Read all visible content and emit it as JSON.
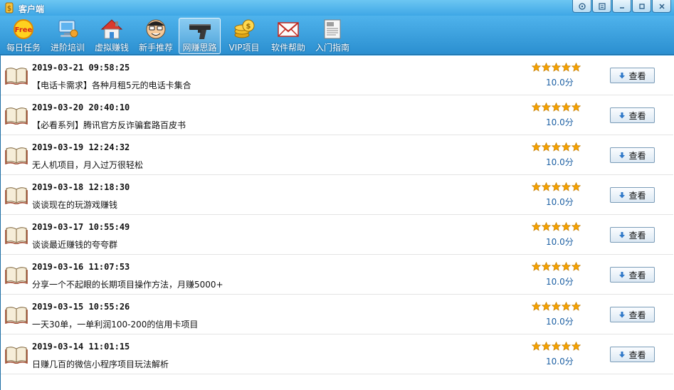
{
  "window": {
    "title": "客户端",
    "controls": [
      "skin-icon",
      "menu-icon",
      "minimize-icon",
      "maximize-icon",
      "close-icon"
    ]
  },
  "toolbar": {
    "items": [
      {
        "label": "每日任务",
        "icon": "free-badge-icon"
      },
      {
        "label": "进阶培训",
        "icon": "computer-icon"
      },
      {
        "label": "虚拟赚钱",
        "icon": "house-icon"
      },
      {
        "label": "新手推荐",
        "icon": "face-icon"
      },
      {
        "label": "网赚思路",
        "icon": "gun-icon",
        "active": true
      },
      {
        "label": "VIP项目",
        "icon": "coins-icon"
      },
      {
        "label": "软件帮助",
        "icon": "envelope-icon"
      },
      {
        "label": "入门指南",
        "icon": "newspaper-icon"
      }
    ]
  },
  "list": {
    "view_label": "查看",
    "rows": [
      {
        "date": "2019-03-21 09:58:25",
        "title": "【电话卡需求】各种月租5元的电话卡集合",
        "rating": 5,
        "score": "10.0分"
      },
      {
        "date": "2019-03-20 20:40:10",
        "title": "【必看系列】腾讯官方反诈骗套路百皮书",
        "rating": 5,
        "score": "10.0分"
      },
      {
        "date": "2019-03-19 12:24:32",
        "title": "无人机项目，月入过万很轻松",
        "rating": 5,
        "score": "10.0分"
      },
      {
        "date": "2019-03-18 12:18:30",
        "title": "谈谈现在的玩游戏赚钱",
        "rating": 5,
        "score": "10.0分"
      },
      {
        "date": "2019-03-17 10:55:49",
        "title": "谈谈最近赚钱的夸夸群",
        "rating": 5,
        "score": "10.0分"
      },
      {
        "date": "2019-03-16 11:07:53",
        "title": "分享一个不起眼的长期项目操作方法，月赚5000+",
        "rating": 5,
        "score": "10.0分"
      },
      {
        "date": "2019-03-15 10:55:26",
        "title": "一天30单，一单利润100-200的信用卡项目",
        "rating": 5,
        "score": "10.0分"
      },
      {
        "date": "2019-03-14 11:01:15",
        "title": "日赚几百的微信小程序项目玩法解析",
        "rating": 5,
        "score": "10.0分"
      }
    ]
  },
  "colors": {
    "titlebar": "#3ea7e6",
    "toolbar": "#2b8fd0",
    "star": "#f5a100",
    "score_text": "#1b5fa3"
  }
}
